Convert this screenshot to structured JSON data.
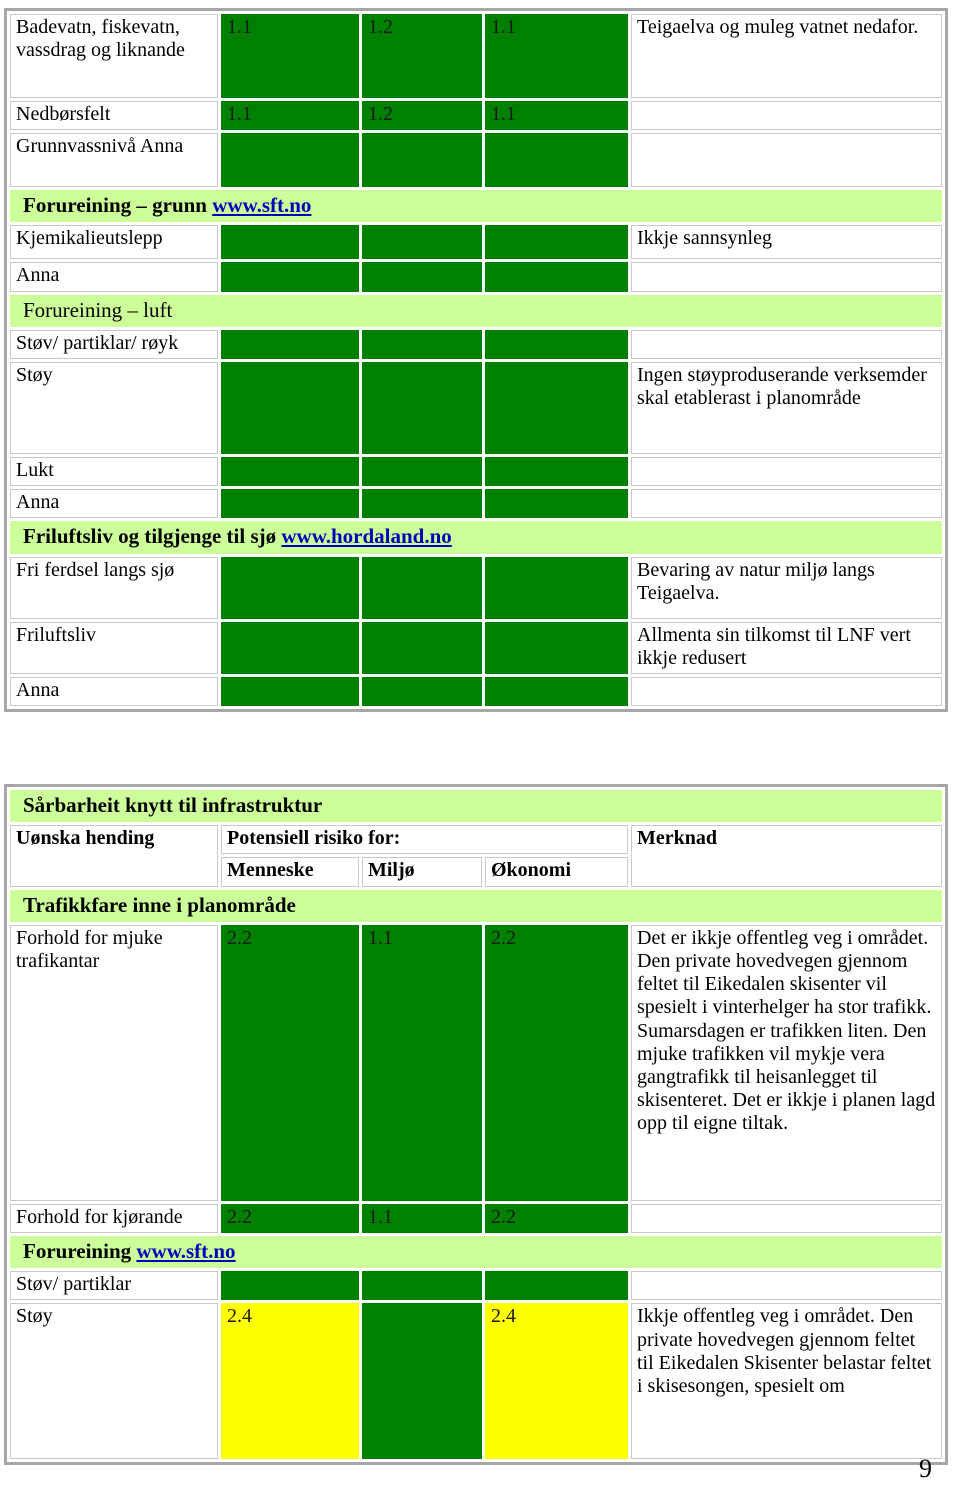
{
  "document": {
    "page_number": "9",
    "colors": {
      "risk_green": "#008000",
      "risk_yellow": "#ffff00",
      "band_green": "#ccff99",
      "link_blue": "#0000bb",
      "table_border": "#a6a6a6"
    }
  },
  "table1": {
    "rows": [
      {
        "type": "data",
        "label": "Badevatn, fiskevatn, vassdrag og liknande",
        "menneske": "1.1",
        "miljo": "1.2",
        "okonomi": "1.1",
        "merknad": "Teigaelva og muleg vatnet nedafor."
      },
      {
        "type": "data",
        "label": "Nedbørsfelt",
        "menneske": "1.1",
        "miljo": "1.2",
        "okonomi": "1.1",
        "merknad": ""
      },
      {
        "type": "data",
        "label": "Grunnvassnivå Anna",
        "menneske": "",
        "miljo": "",
        "okonomi": "",
        "merknad": ""
      },
      {
        "type": "band",
        "bold": true,
        "title": "Forureining – grunn ",
        "link": "www.sft.no"
      },
      {
        "type": "data",
        "label": "Kjemikalieutslepp",
        "menneske": "",
        "miljo": "",
        "okonomi": "",
        "merknad": "Ikkje sannsynleg"
      },
      {
        "type": "data",
        "label": "Anna",
        "menneske": "",
        "miljo": "",
        "okonomi": "",
        "merknad": ""
      },
      {
        "type": "band",
        "bold": false,
        "title": "Forureining – luft",
        "link": ""
      },
      {
        "type": "data",
        "label": "Støv/ partiklar/ røyk",
        "menneske": "",
        "miljo": "",
        "okonomi": "",
        "merknad": ""
      },
      {
        "type": "data",
        "label": "Støy",
        "menneske": "",
        "miljo": "",
        "okonomi": "",
        "merknad": "Ingen støyproduserande verksemder skal etablerast i planområde"
      },
      {
        "type": "data",
        "label": "Lukt",
        "menneske": "",
        "miljo": "",
        "okonomi": "",
        "merknad": ""
      },
      {
        "type": "data",
        "label": "Anna",
        "menneske": "",
        "miljo": "",
        "okonomi": "",
        "merknad": ""
      },
      {
        "type": "band",
        "bold": true,
        "title": "Friluftsliv og tilgjenge til sjø ",
        "link": "www.hordaland.no"
      },
      {
        "type": "data",
        "label": "Fri ferdsel langs sjø",
        "menneske": "",
        "miljo": "",
        "okonomi": "",
        "merknad": "Bevaring av natur miljø langs Teigaelva."
      },
      {
        "type": "data",
        "label": "Friluftsliv",
        "menneske": "",
        "miljo": "",
        "okonomi": "",
        "merknad": "Allmenta sin tilkomst til LNF vert ikkje redusert"
      },
      {
        "type": "data",
        "label": "Anna",
        "menneske": "",
        "miljo": "",
        "okonomi": "",
        "merknad": ""
      }
    ]
  },
  "table2": {
    "section_title": "Sårbarheit knytt til infrastruktur",
    "header": {
      "col_hending": "Uønska hending",
      "col_risiko": "Potensiell risiko for:",
      "col_merknad": "Merknad",
      "sub_menneske": "Menneske",
      "sub_miljo": "Miljø",
      "sub_okonomi": "Økonomi",
      "sub_merknad": ""
    },
    "rows": [
      {
        "type": "band",
        "bold": true,
        "title": "Trafikkfare inne i planområde",
        "link": ""
      },
      {
        "type": "data",
        "label": "Forhold for mjuke trafikantar",
        "menneske": "2.2",
        "miljo": "1.1",
        "okonomi": "2.2",
        "merknad": "Det er ikkje offentleg veg i området. Den private hovedvegen gjennom feltet til Eikedalen skisenter vil spesielt i vinterhelger ha stor trafikk. Sumarsdagen er trafikken liten. Den mjuke trafikken vil mykje vera gangtrafikk til heisanlegget til skisenteret. Det er ikkje i planen lagd opp til eigne tiltak."
      },
      {
        "type": "data",
        "label": "Forhold for kjørande",
        "menneske": "2.2",
        "miljo": "1.1",
        "okonomi": "2.2",
        "merknad": ""
      },
      {
        "type": "band",
        "bold": true,
        "title": "Forureining ",
        "link": "www.sft.no"
      },
      {
        "type": "data",
        "label": "Støv/ partiklar",
        "menneske": "",
        "miljo": "",
        "okonomi": "",
        "merknad": ""
      },
      {
        "type": "data",
        "label": "Støy",
        "menneske": "2.4",
        "miljo": "",
        "okonomi": "2.4",
        "merknad": "Ikkje offentleg veg i området. Den private hovedvegen gjennom feltet til Eikedalen Skisenter belastar feltet i skisesongen, spesielt om"
      }
    ]
  }
}
